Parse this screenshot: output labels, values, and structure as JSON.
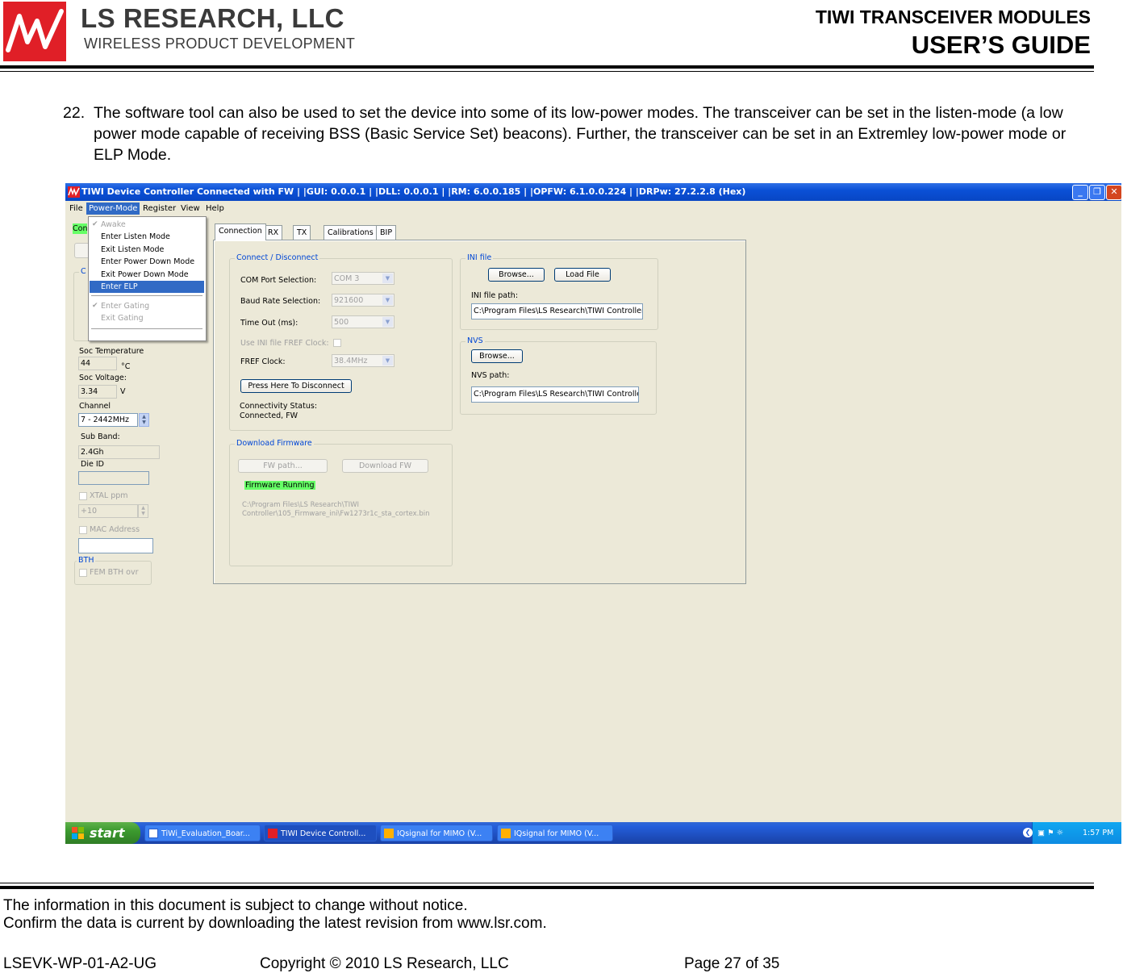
{
  "document": {
    "brand_name": "LS RESEARCH, LLC",
    "brand_tagline": "WIRELESS PRODUCT DEVELOPMENT",
    "title_line1": "TIWI TRANSCEIVER MODULES",
    "title_line2": "USER’S GUIDE",
    "step_number": "22.",
    "step_text": "The software tool can also be used to set the device into some of its low-power modes. The transceiver can be set in the listen-mode (a low power mode capable of receiving  BSS (Basic Service Set) beacons). Further, the transceiver can be set in an Extremley low-power mode or ELP Mode.",
    "footer_line1": "The information in this document is subject to change without notice.",
    "footer_line2": "Confirm the data is current by downloading the latest revision from www.lsr.com.",
    "doc_id": "LSEVK-WP-01-A2-UG",
    "copyright": "Copyright © 2010 LS Research, LLC",
    "page": "Page 27 of 35"
  },
  "window": {
    "title": "TIWI Device Controller Connected with FW | |GUI: 0.0.0.1 | |DLL: 0.0.0.1 | |RM: 6.0.0.185 | |OPFW: 6.1.0.0.224 | |DRPw: 27.2.2.8 (Hex)",
    "menu": [
      "File",
      "Power-Mode",
      "Register",
      "View",
      "Help"
    ],
    "power_menu": {
      "awake": "Awake",
      "enter_listen": "Enter Listen Mode",
      "exit_listen": "Exit Listen Mode",
      "enter_power_down": "Enter Power Down Mode",
      "exit_power_down": "Exit Power Down Mode",
      "enter_elp": "Enter ELP",
      "enter_gating": "Enter Gating",
      "exit_gating": "Exit Gating"
    },
    "left": {
      "status_partial": "Con",
      "group_partial": "C",
      "soc_temp_label": "Soc Temperature",
      "soc_temp_value": "44",
      "soc_temp_unit": "°C",
      "soc_voltage_label": "Soc Voltage:",
      "soc_voltage_value": "3.34",
      "soc_voltage_unit": "V",
      "channel_label": "Channel",
      "channel_value": "7 - 2442MHz",
      "sub_band_label": "Sub Band:",
      "sub_band_value": "2.4Gh",
      "die_id_label": "Die ID",
      "xtal_label": "XTAL ppm",
      "xtal_value": "+10",
      "mac_label": "MAC Address",
      "bth_title": "BTH",
      "fem_label": "FEM BTH ovr"
    },
    "tabs": [
      "Connection",
      "RX",
      "TX",
      "Calibrations",
      "BIP"
    ],
    "connection": {
      "title": "Connect / Disconnect",
      "com_port_label": "COM Port Selection:",
      "com_port_value": "COM 3",
      "baud_label": "Baud Rate Selection:",
      "baud_value": "921600",
      "timeout_label": "Time Out (ms):",
      "timeout_value": "500",
      "use_ini_label": "Use INI file FREF Clock:",
      "fref_label": "FREF Clock:",
      "fref_value": "38.4MHz",
      "disconnect_button": "Press Here To Disconnect",
      "status_label": "Connectivity Status:",
      "status_value": "Connected, FW"
    },
    "ini": {
      "title": "INI file",
      "browse": "Browse...",
      "load": "Load File",
      "path_label": "INI file path:",
      "path_value": "C:\\Program Files\\LS Research\\TIWI Controller\\"
    },
    "nvs": {
      "title": "NVS",
      "browse": "Browse...",
      "path_label": "NVS path:",
      "path_value": "C:\\Program Files\\LS Research\\TIWI Controller"
    },
    "firmware": {
      "title": "Download Firmware",
      "fw_path_button": "FW path...",
      "download_button": "Download FW",
      "status": "Firmware Running",
      "path_line1": "C:\\Program Files\\LS Research\\TIWI",
      "path_line2": "Controller\\105_Firmware_ini\\Fw1273r1c_sta_cortex.bin"
    },
    "taskbar": {
      "start": "start",
      "tasks": [
        "TiWi_Evaluation_Boar...",
        "TIWI Device Controll...",
        "IQsignal for MIMO (V...",
        "IQsignal for MIMO (V..."
      ],
      "clock": "1:57 PM"
    }
  },
  "colors": {
    "xp_title_blue": "#0a50d6",
    "menu_highlight": "#316ac5",
    "group_title_blue": "#0046d5",
    "firmware_green": "#66ff66",
    "logo_red": "#e01f27"
  }
}
